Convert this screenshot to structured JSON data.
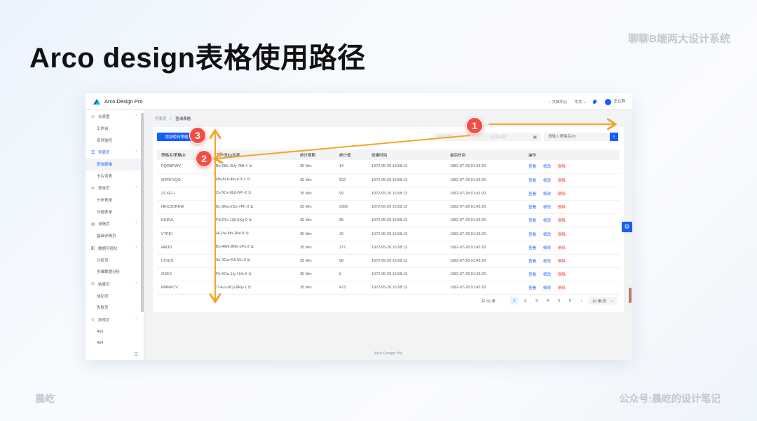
{
  "slide": {
    "title": "Arco design表格使用路径",
    "series": "聊聊B端两大设计系统",
    "author": "晨屹",
    "wechat": "公众号:晨屹的设计笔记"
  },
  "app": {
    "brand": "Arco Design Pro",
    "topbar": {
      "docs": "文档中心",
      "lang": "中文 ⌄",
      "user": "王立群"
    },
    "breadcrumb": {
      "parent": "列表页",
      "current": "查询表格"
    },
    "footer": "Arco Design Pro"
  },
  "sidebar": {
    "groups": [
      {
        "icon": "⊙",
        "label": "仪表盘",
        "active": false,
        "items": [
          {
            "label": "工作台",
            "active": false
          },
          {
            "label": "实时监控",
            "active": false
          }
        ]
      },
      {
        "icon": "☰",
        "label": "列表页",
        "active": true,
        "items": [
          {
            "label": "查询表格",
            "active": true
          },
          {
            "label": "卡片列表",
            "active": false
          }
        ]
      },
      {
        "icon": "⊛",
        "label": "表单页",
        "active": false,
        "items": [
          {
            "label": "分步表单",
            "active": false
          },
          {
            "label": "分组表单",
            "active": false
          }
        ]
      },
      {
        "icon": "▤",
        "label": "详情页",
        "active": false,
        "items": [
          {
            "label": "基础详情页",
            "active": false
          }
        ]
      },
      {
        "icon": "◧",
        "label": "数据可视化",
        "active": false,
        "items": [
          {
            "label": "分析页",
            "active": false
          },
          {
            "label": "多维数据分析",
            "active": false
          }
        ]
      },
      {
        "icon": "⊘",
        "label": "结果页",
        "active": false,
        "items": [
          {
            "label": "成功页",
            "active": false
          },
          {
            "label": "失败页",
            "active": false
          }
        ]
      },
      {
        "icon": "⊙",
        "label": "异常页",
        "active": false,
        "items": [
          {
            "label": "403",
            "active": false
          },
          {
            "label": "404",
            "active": false
          }
        ]
      }
    ]
  },
  "toolbar": {
    "new_button": "添加转码策略",
    "start_date": "开始日期",
    "end_date": "结束日期",
    "search_placeholder": "请输入策略名/ID"
  },
  "table": {
    "headers": [
      "策略名/策略ID",
      "工作流ID/名称",
      "统计周期",
      "统计值",
      "创建时间",
      "最后时间",
      "操作"
    ],
    "rows": [
      [
        "PQRBPWV",
        "Bh-5Kk-3Uy-7Ml-4",
        "35 Min",
        "14",
        "1972-05-20 16:58:13",
        "1982-07-28 01:43:20"
      ],
      [
        "MPRFXQO",
        "Mq-8Ln-4lo-4Tf-1",
        "35 Min",
        "522",
        "1972-05-20 16:58:13",
        "1982-07-28 01:43:20"
      ],
      [
        "ZCXFLJ",
        "Zu-5Cx-6Lb-6Pr-2",
        "35 Min",
        "99",
        "1972-05-20 16:58:13",
        "1982-07-28 01:43:20"
      ],
      [
        "HKCDCRKW",
        "Bc-3Kw-2So-7Ph-3",
        "35 Min",
        "2366",
        "1972-05-20 16:58:13",
        "1982-07-28 01:43:20"
      ],
      [
        "KHDVL",
        "Pd-0Yc-1Qi-0Xg-9",
        "35 Min",
        "65",
        "1972-05-20 16:58:13",
        "1982-07-28 01:43:20"
      ],
      [
        "VTPEI",
        "Hi-2Iu-8In-1Be-8",
        "35 Min",
        "42",
        "1972-05-20 16:58:13",
        "1982-07-28 01:43:20"
      ],
      [
        "HMJD",
        "Bn-4Wk-8Nh-1Ps-3",
        "35 Min",
        "277",
        "1972-05-20 16:58:13",
        "1982-07-28 01:43:20"
      ],
      [
        "LTSUS",
        "Sz-2Gw-6Jl-5Iu-3",
        "35 Min",
        "58",
        "1972-05-20 16:58:13",
        "1982-07-28 01:43:20"
      ],
      [
        "OSEX",
        "Pk-5Ou-1Iy-1Hh-6",
        "35 Min",
        "6",
        "1972-05-20 16:58:13",
        "1982-07-28 01:43:20"
      ],
      [
        "RMRKCV",
        "Tf-4Jx-8Cy-8Rp-1",
        "35 Min",
        "473",
        "1972-05-20 16:58:13",
        "1982-07-28 01:43:20"
      ]
    ],
    "actions": [
      "查看",
      "修改",
      "删除"
    ]
  },
  "pagination": {
    "total": "共 55 条",
    "pages": [
      "1",
      "2",
      "3",
      "4",
      "5",
      "6"
    ],
    "current": "1",
    "page_size": "10 条/页"
  },
  "annotations": {
    "badges": [
      "1",
      "2",
      "3"
    ],
    "color": "#f5a524"
  }
}
